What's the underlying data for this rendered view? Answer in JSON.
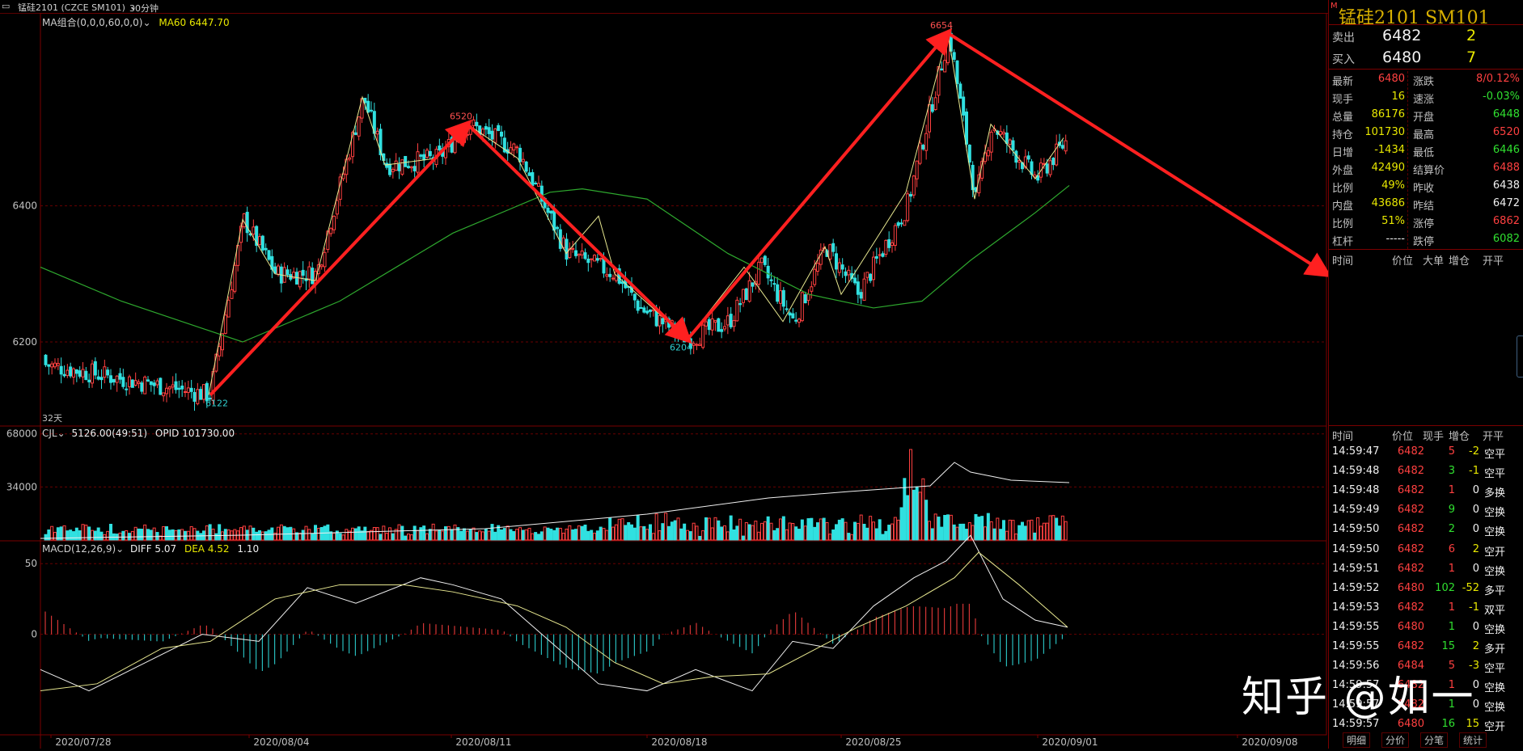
{
  "topbar": {
    "symbol": "锰硅2101 (CZCE SM101)",
    "period": "30分钟"
  },
  "main": {
    "ma_label": "MA组合(0,0,0,60,0,0)",
    "ma60_label": "MA60 6447.70",
    "days_label": "32天",
    "peak_labels": [
      "6122",
      "6520",
      "6204",
      "6654"
    ],
    "y_ticks": [
      "6400",
      "6200"
    ]
  },
  "volume": {
    "label": "CJL",
    "value": "5126.00(49:51)",
    "opi": "OPID 101730.00",
    "y_ticks": [
      "68000",
      "34000"
    ]
  },
  "macd": {
    "label": "MACD(12,26,9)",
    "diff": "DIFF 5.07",
    "dea": "DEA 4.52",
    "macd_val": "1.10",
    "y_ticks": [
      "50",
      "0"
    ]
  },
  "x_ticks": [
    "2020/07/28",
    "2020/08/04",
    "2020/08/11",
    "2020/08/18",
    "2020/08/25",
    "2020/09/01",
    "2020/09/08"
  ],
  "quote": {
    "title": "锰硅2101  SM101",
    "mark": "M",
    "sell_label": "卖出",
    "sell_price": "6482",
    "sell_qty": "2",
    "buy_label": "买入",
    "buy_price": "6480",
    "buy_qty": "7",
    "rows": [
      {
        "l1": "最新",
        "v1": "6480",
        "l2": "涨跌",
        "v2": "8/0.12%"
      },
      {
        "l1": "现手",
        "v1": "16",
        "l2": "速涨",
        "v2": "-0.03%"
      },
      {
        "l1": "总量",
        "v1": "86176",
        "l2": "开盘",
        "v2": "6448"
      },
      {
        "l1": "持仓",
        "v1": "101730",
        "l2": "最高",
        "v2": "6520"
      },
      {
        "l1": "日增",
        "v1": "-1434",
        "l2": "最低",
        "v2": "6446"
      },
      {
        "l1": "外盘",
        "v1": "42490",
        "l2": "结算价",
        "v2": "6488"
      },
      {
        "l1": "比例",
        "v1": "49%",
        "l2": "昨收",
        "v2": "6438"
      },
      {
        "l1": "内盘",
        "v1": "43686",
        "l2": "昨结",
        "v2": "6472"
      },
      {
        "l1": "比例",
        "v1": "51%",
        "l2": "涨停",
        "v2": "6862"
      },
      {
        "l1": "杠杆",
        "v1": "-----",
        "l2": "跌停",
        "v2": "6082"
      }
    ],
    "header1": [
      "时间",
      "价位",
      "大单",
      "增仓",
      "开平"
    ],
    "header2": [
      "时间",
      "价位",
      "现手",
      "增仓",
      "开平"
    ],
    "trades": [
      [
        "14:59:47",
        "6482",
        "5",
        "-2",
        "空平"
      ],
      [
        "14:59:48",
        "6482",
        "3",
        "-1",
        "空平"
      ],
      [
        "14:59:48",
        "6482",
        "1",
        "0",
        "多换"
      ],
      [
        "14:59:49",
        "6482",
        "9",
        "0",
        "空换"
      ],
      [
        "14:59:50",
        "6482",
        "2",
        "0",
        "空换"
      ],
      [
        "14:59:50",
        "6482",
        "6",
        "2",
        "空开"
      ],
      [
        "14:59:51",
        "6482",
        "1",
        "0",
        "空换"
      ],
      [
        "14:59:52",
        "6480",
        "102",
        "-52",
        "多平"
      ],
      [
        "14:59:53",
        "6482",
        "1",
        "-1",
        "双平"
      ],
      [
        "14:59:55",
        "6480",
        "1",
        "0",
        "空换"
      ],
      [
        "14:59:55",
        "6482",
        "15",
        "2",
        "多开"
      ],
      [
        "14:59:56",
        "6484",
        "5",
        "-3",
        "空平"
      ],
      [
        "14:59:57",
        "6482",
        "1",
        "0",
        "空换"
      ],
      [
        "14:59:57",
        "6482",
        "1",
        "0",
        "空换"
      ],
      [
        "14:59:57",
        "6480",
        "16",
        "15",
        "空开"
      ]
    ],
    "tabs": [
      "明细",
      "分价",
      "分笔",
      "统计"
    ]
  },
  "watermark": "知乎 @如一",
  "colors": {
    "up": "#ff4040",
    "down": "#30e0e0",
    "ma60": "#2ea82e",
    "arrow": "#ff2020",
    "zigzag": "#e8e890",
    "grid": "#7a0000"
  },
  "chart_data": [
    {
      "type": "candlestick",
      "title": "锰硅2101 (CZCE SM101) 30分钟",
      "x_ticks": [
        "2020/07/28",
        "2020/08/04",
        "2020/08/11",
        "2020/08/18",
        "2020/08/25",
        "2020/09/01",
        "2020/09/08"
      ],
      "ylim": [
        6080,
        6680
      ],
      "y_ticks": [
        6200,
        6400
      ],
      "pivots": [
        {
          "label": "6122",
          "value": 6122,
          "type": "low"
        },
        {
          "label": "6520",
          "value": 6520,
          "type": "high"
        },
        {
          "label": "6204",
          "value": 6204,
          "type": "low"
        },
        {
          "label": "6654",
          "value": 6654,
          "type": "high"
        }
      ],
      "zigzag": [
        6180,
        6122,
        6380,
        6300,
        6560,
        6470,
        6520,
        6420,
        6380,
        6204,
        6310,
        6230,
        6340,
        6270,
        6654,
        6410,
        6520,
        6440,
        6500
      ],
      "ma60": {
        "name": "MA60",
        "last": 6447.7
      },
      "trend_arrows": [
        [
          6122,
          6520
        ],
        [
          6520,
          6204
        ],
        [
          6204,
          6654
        ],
        [
          6654,
          6300
        ]
      ]
    },
    {
      "type": "bar",
      "title": "CJL",
      "series": [
        {
          "name": "CJL",
          "last": 5126
        },
        {
          "name": "OPID",
          "last": 101730
        }
      ],
      "y_ticks": [
        34000,
        68000
      ],
      "ylim": [
        0,
        72000
      ]
    },
    {
      "type": "bar",
      "title": "MACD(12,26,9)",
      "series": [
        {
          "name": "DIFF",
          "last": 5.07
        },
        {
          "name": "DEA",
          "last": 4.52
        },
        {
          "name": "MACD",
          "last": 1.1
        }
      ],
      "y_ticks": [
        0,
        50
      ],
      "ylim": [
        -70,
        65
      ]
    }
  ]
}
